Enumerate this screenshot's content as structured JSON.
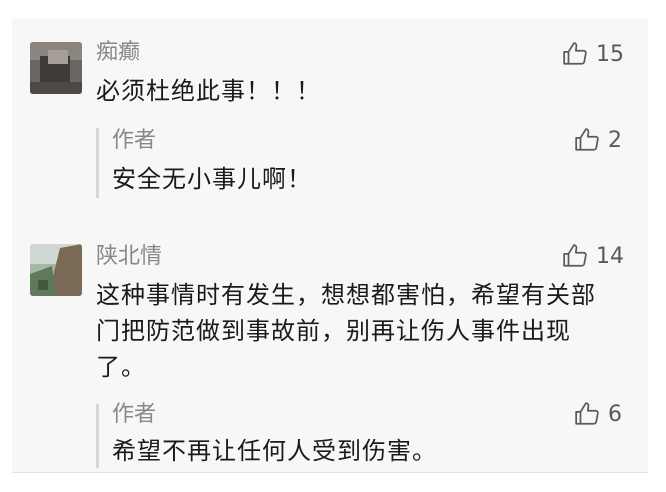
{
  "comments": [
    {
      "author": "痴癫",
      "text": "必须杜绝此事！！！",
      "likes": "15",
      "reply": {
        "author": "作者",
        "text": "安全无小事儿啊！",
        "likes": "2"
      }
    },
    {
      "author": "陕北情",
      "text_lines": [
        "这种事情时有发生，想想都害怕，希望有关部",
        "门把防范做到事故前，别再让伤人事件出现",
        "了。"
      ],
      "likes": "14",
      "reply": {
        "author": "作者",
        "text": "希望不再让任何人受到伤害。",
        "likes": "6"
      }
    }
  ],
  "icons": {
    "like": "thumbs-up-icon"
  },
  "colors": {
    "panel_bg": "#f7f7f7",
    "name": "#888888",
    "text": "#1a1a1a",
    "reply_bar": "#d6d6d6"
  }
}
